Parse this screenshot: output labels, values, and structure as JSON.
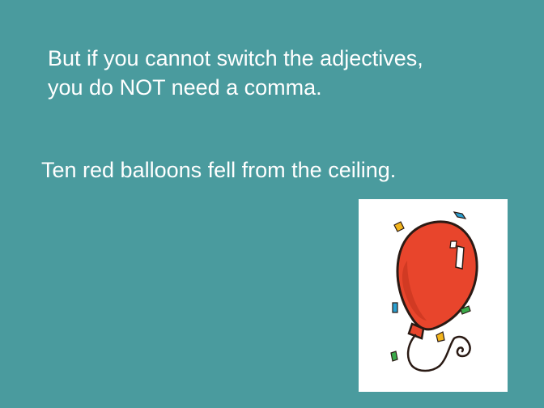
{
  "slide": {
    "background_color": "#4A9B9E",
    "text_color": "#FFFFFF",
    "heading_lines": [
      "But if you cannot switch the adjectives,",
      "you do NOT need a comma."
    ],
    "example_sentence": "Ten red balloons fell from the ceiling.",
    "clipart": {
      "icon": "balloon-with-confetti-icon",
      "balloon_color": "#E8452C",
      "confetti_colors": [
        "#F2B41C",
        "#2A9FD0",
        "#3BAA4A"
      ]
    }
  }
}
